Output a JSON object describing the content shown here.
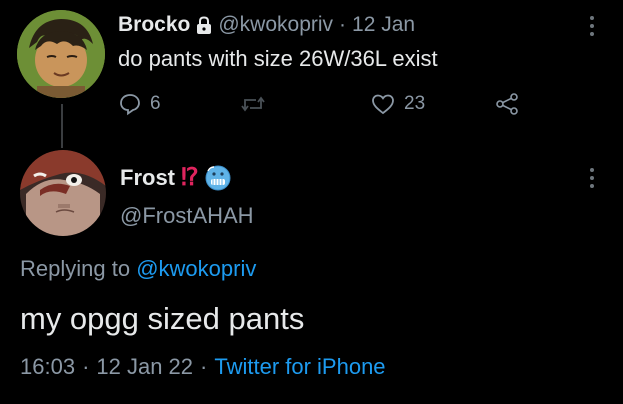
{
  "tweet1": {
    "name": "Brocko",
    "handle": "@kwokopriv",
    "separator": "·",
    "date": "12 Jan",
    "text": "do pants with size 26W/36L exist",
    "replies": "6",
    "likes": "23",
    "icons": [
      "lock-icon",
      "reply-icon",
      "retweet-icon",
      "like-icon",
      "share-icon",
      "more-icon"
    ]
  },
  "tweet2": {
    "name": "Frost",
    "badge": "⁉",
    "emoji": "🥶",
    "handle": "@FrostAHAH",
    "replying_prefix": "Replying to",
    "replying_handle": "@kwokopriv",
    "text": "my opgg sized pants",
    "time": "16:03",
    "date": "12 Jan 22",
    "separator": "·",
    "source": "Twitter for iPhone",
    "icons": [
      "more-icon"
    ]
  },
  "colors": {
    "background": "#000000",
    "text": "#e7e9ea",
    "muted": "#8b98a5",
    "accent": "#1d9bf0",
    "badge_red": "#e0245e"
  }
}
